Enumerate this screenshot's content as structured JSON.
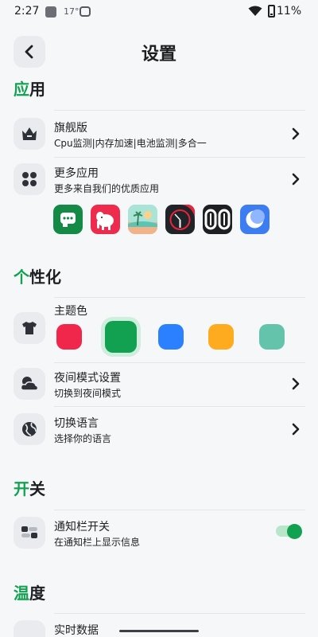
{
  "status_bar": {
    "time": "2:27",
    "temp": "17°",
    "battery": "11%"
  },
  "header": {
    "title": "设置"
  },
  "sections": {
    "app": {
      "hl": "应",
      "rest": "用"
    },
    "personal": {
      "hl": "个",
      "rest": "性化"
    },
    "switches": {
      "hl": "开",
      "rest": "关"
    },
    "temperature": {
      "hl": "温",
      "rest": "度"
    }
  },
  "rows": {
    "flagship": {
      "title": "旗舰版",
      "subtitle": "Cpu监测|内存加速|电池监测|多合一"
    },
    "more_apps": {
      "title": "更多应用",
      "subtitle": "更多来自我们的优质应用"
    },
    "theme_color": {
      "title": "主题色"
    },
    "night_mode": {
      "title": "夜间模式设置",
      "subtitle": "切换到夜间模式"
    },
    "language": {
      "title": "切换语言",
      "subtitle": "选择你的语言"
    },
    "notification": {
      "title": "通知栏开关",
      "subtitle": "在通知栏上显示信息",
      "enabled": true
    },
    "temp_row": {
      "title": "实时数据"
    }
  },
  "theme_colors": [
    {
      "name": "red",
      "hex": "#f0264a"
    },
    {
      "name": "green",
      "hex": "#12a150",
      "selected": true
    },
    {
      "name": "blue",
      "hex": "#2b80ff"
    },
    {
      "name": "orange",
      "hex": "#ffab1f"
    },
    {
      "name": "teal",
      "hex": "#63c3ab"
    }
  ],
  "accent": "#12a150",
  "app_icons": [
    "chat-app-icon",
    "elephant-app-icon",
    "beach-app-icon",
    "clock-app-icon",
    "digital-clock-app-icon",
    "moon-app-icon"
  ]
}
